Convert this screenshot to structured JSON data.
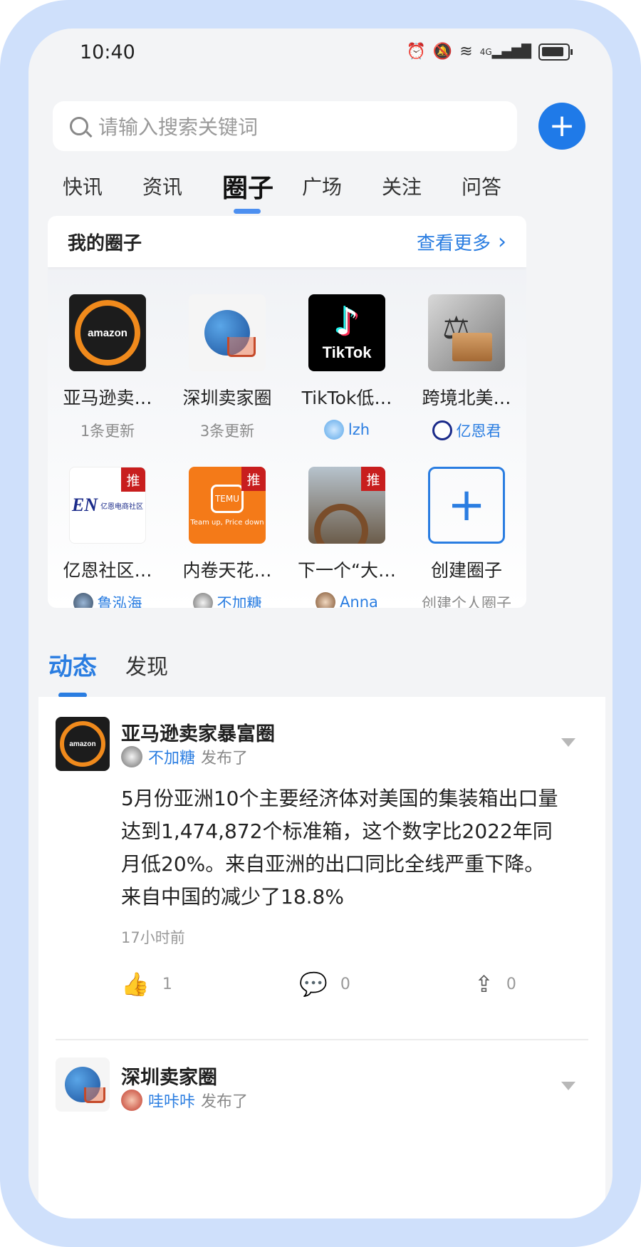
{
  "status_bar": {
    "time": "10:40",
    "network": "4G"
  },
  "search": {
    "placeholder": "请输入搜索关键词"
  },
  "top_tabs": [
    "快讯",
    "资讯",
    "圈子",
    "广场",
    "关注",
    "问答"
  ],
  "active_tab": "圈子",
  "my_circles": {
    "title": "我的圈子",
    "more_label": "查看更多",
    "items": [
      {
        "name": "亚马逊卖…",
        "sub": "1条更新",
        "thumb": "amazon",
        "badge": ""
      },
      {
        "name": "深圳卖家圈",
        "sub": "3条更新",
        "thumb": "globe-cart",
        "badge": ""
      },
      {
        "name": "TikTok低…",
        "sub": "lzh",
        "thumb": "tiktok",
        "badge": ""
      },
      {
        "name": "跨境北美…",
        "sub": "亿恩君",
        "thumb": "law-scale",
        "badge": ""
      },
      {
        "name": "亿恩社区…",
        "sub": "鲁泓海",
        "thumb": "en-logo",
        "badge": "推"
      },
      {
        "name": "内卷天花…",
        "sub": "不加糖",
        "thumb": "temu",
        "badge": "推"
      },
      {
        "name": "下一个“大…",
        "sub": "Anna",
        "thumb": "ship-wheel",
        "badge": "推"
      },
      {
        "name": "创建圈子",
        "sub": "创建个人圈子",
        "thumb": "create",
        "badge": ""
      }
    ],
    "thumb_text": {
      "amazon": "amazon",
      "tiktok": "TikTok",
      "en": "EN",
      "en_sub": "亿恩电商社区",
      "temu": "TEMU",
      "temu_tag": "Team up, Price down"
    }
  },
  "feed_tabs": [
    "动态",
    "发现"
  ],
  "active_feed_tab": "动态",
  "posts": [
    {
      "circle": "亚马逊卖家暴富圈",
      "author": "不加糖",
      "verb": "发布了",
      "body": "5月份亚洲10个主要经济体对美国的集装箱出口量达到1,474,872个标准箱，这个数字比2022年同月低20%。来自亚洲的出口同比全线严重下降。来自中国的减少了18.8%",
      "time": "17小时前",
      "likes": "1",
      "comments": "0",
      "shares": "0"
    },
    {
      "circle": "深圳卖家圈",
      "author": "哇咔咔",
      "verb": "发布了"
    }
  ],
  "colors": {
    "accent": "#1f7ae8",
    "link": "#2a7de1",
    "badge": "#c81e1e",
    "frame": "#cfe0fb"
  },
  "icons": [
    "search-icon",
    "plus-icon",
    "chevron-right-icon",
    "like-icon",
    "comment-icon",
    "share-icon",
    "caret-down-icon"
  ]
}
